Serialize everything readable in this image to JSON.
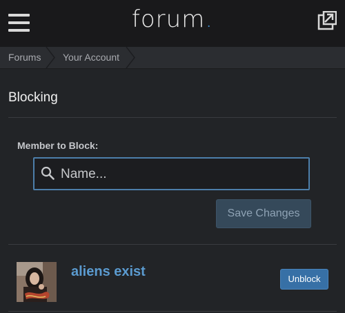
{
  "header": {
    "brand": "forum",
    "brand_dot": ".",
    "menu_icon": "hamburger-menu-icon",
    "share_icon": "external-share-icon",
    "accent_color": "#3d8fd6"
  },
  "breadcrumb": {
    "items": [
      "Forums",
      "Your Account"
    ]
  },
  "page": {
    "title": "Blocking"
  },
  "block_form": {
    "label": "Member to Block:",
    "search_placeholder": "Name...",
    "search_value": "",
    "save_label": "Save Changes"
  },
  "blocked_members": [
    {
      "username": "aliens exist",
      "action_label": "Unblock"
    }
  ]
}
